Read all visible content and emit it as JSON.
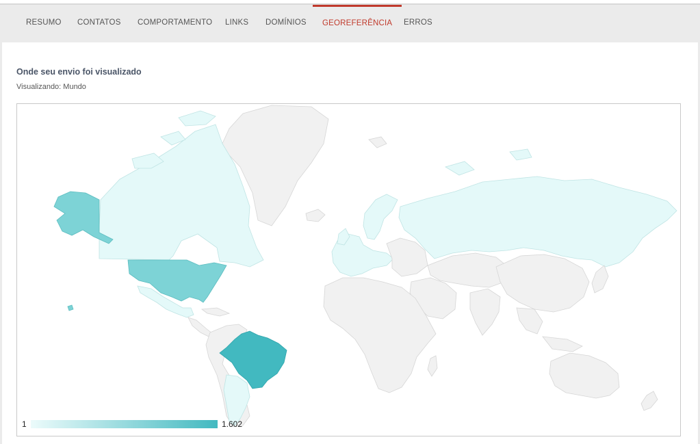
{
  "tabs": [
    {
      "label": "RESUMO"
    },
    {
      "label": "CONTATOS"
    },
    {
      "label": "COMPORTAMENTO"
    },
    {
      "label": "LINKS"
    },
    {
      "label": "DOMÍNIOS"
    },
    {
      "label": "GEOREFERÊNCIA",
      "active": true
    },
    {
      "label": "ERROS"
    }
  ],
  "section": {
    "title": "Onde seu envio foi visualizado",
    "viewing": "Visualizando: Mundo"
  },
  "map": {
    "region": "Mundo",
    "legend": {
      "min": "1",
      "max": "1.602",
      "color_min": "#ecfbfb",
      "color_max": "#42b9c0"
    },
    "highlighted": [
      {
        "country": "Brazil",
        "level": "high"
      },
      {
        "country": "United States",
        "level": "mid"
      },
      {
        "country": "Canada",
        "level": "low"
      },
      {
        "country": "Russia",
        "level": "low"
      },
      {
        "country": "Argentina",
        "level": "low"
      },
      {
        "country": "Mexico",
        "level": "low"
      },
      {
        "country": "Western Europe",
        "level": "low"
      }
    ],
    "colors": {
      "no_data": "#f1f1f1",
      "accent": "#c0392b"
    }
  }
}
